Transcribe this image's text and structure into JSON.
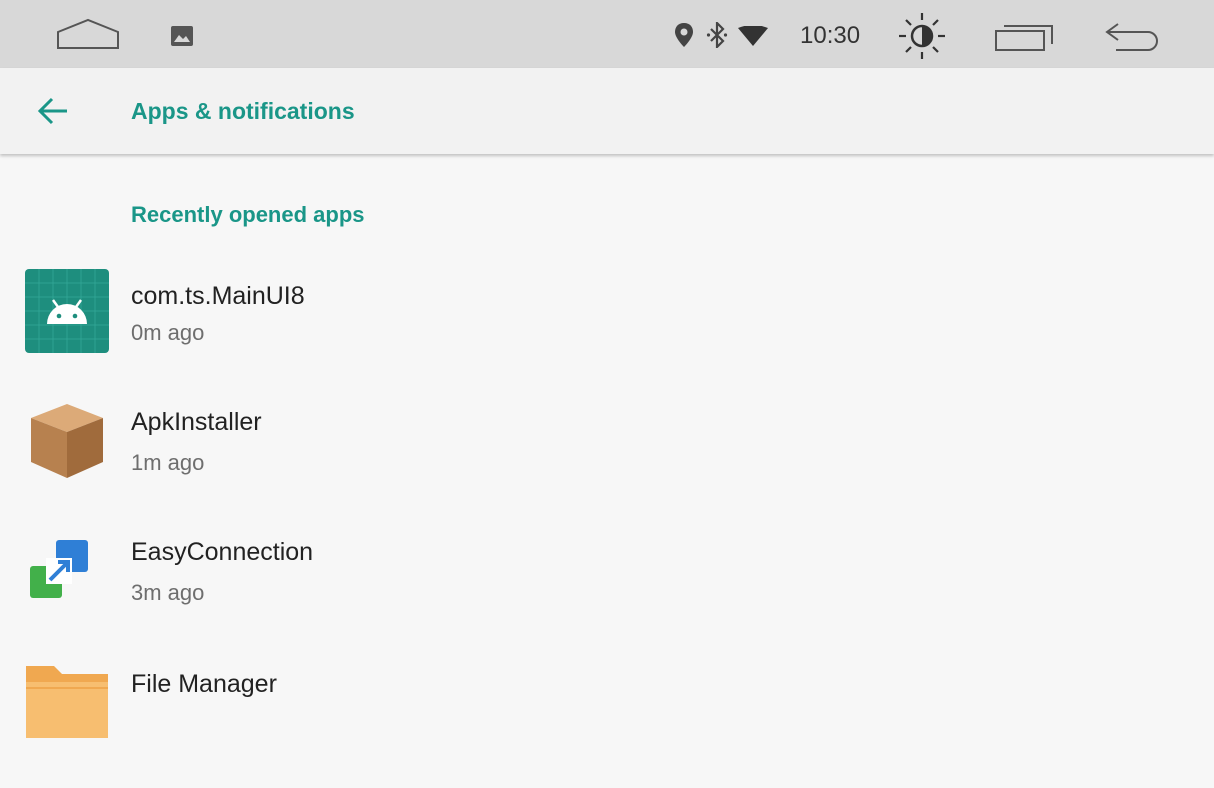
{
  "status_bar": {
    "time": "10:30",
    "icons": [
      "home-icon",
      "gallery-icon",
      "location-icon",
      "bluetooth-icon",
      "wifi-icon",
      "brightness-icon",
      "recents-icon",
      "back-icon"
    ]
  },
  "app_bar": {
    "title": "Apps & notifications",
    "back_icon": "arrow-left-icon"
  },
  "section": {
    "header": "Recently opened apps"
  },
  "apps": [
    {
      "name": "com.ts.MainUI8",
      "time": "0m ago",
      "icon": "android-icon"
    },
    {
      "name": "ApkInstaller",
      "time": "1m ago",
      "icon": "package-box-icon"
    },
    {
      "name": "EasyConnection",
      "time": "3m ago",
      "icon": "easyconnection-icon"
    },
    {
      "name": "File Manager",
      "time": "",
      "icon": "folder-icon"
    }
  ],
  "colors": {
    "accent": "#1a9688",
    "status_bar_bg": "#d8d8d8",
    "app_bar_bg": "#f2f2f2",
    "page_bg": "#f7f7f7"
  }
}
